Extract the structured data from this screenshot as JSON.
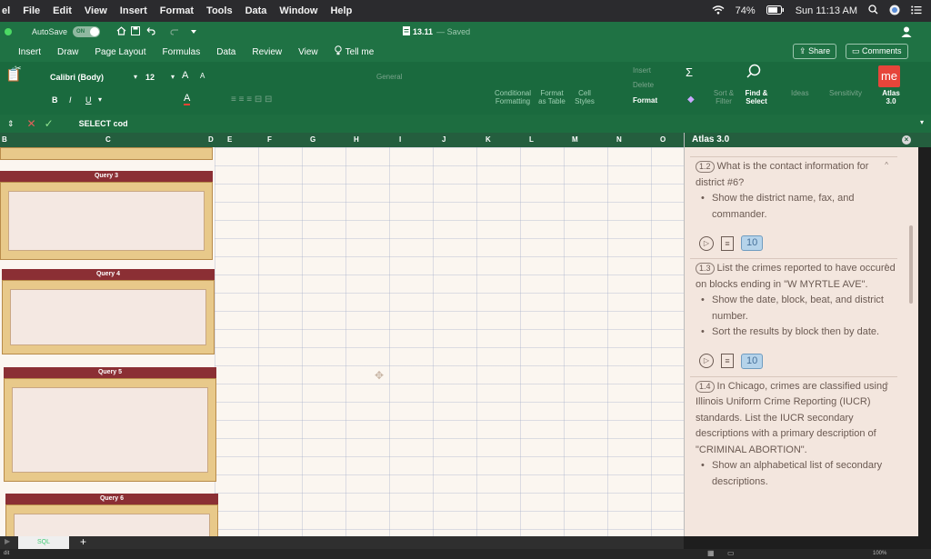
{
  "menubar": {
    "app_fragment": "el",
    "items": [
      "File",
      "Edit",
      "View",
      "Insert",
      "Format",
      "Tools",
      "Data",
      "Window",
      "Help"
    ],
    "battery": "74%",
    "clock": "Sun 11:13 AM"
  },
  "titlebar": {
    "autosave_label": "AutoSave",
    "autosave_state": "ON",
    "doc_name": "13.11",
    "saved": "— Saved"
  },
  "tabs": [
    "Insert",
    "Draw",
    "Page Layout",
    "Formulas",
    "Data",
    "Review",
    "View"
  ],
  "tell_me": "Tell me",
  "share": "Share",
  "comments": "Comments",
  "ribbon": {
    "font_name": "Calibri (Body)",
    "font_size": "12",
    "number_format": "General",
    "conditional_formatting": "Conditional Formatting",
    "format_as_table": "Format as Table",
    "cell_styles": "Cell Styles",
    "insert": "Insert",
    "delete": "Delete",
    "format": "Format",
    "sort_filter": "Sort & Filter",
    "find_select": "Find & Select",
    "ideas": "Ideas",
    "sensitivity": "Sensitivity",
    "atlas_logo": "me",
    "atlas_label": "Atlas 3.0"
  },
  "formula": {
    "content": "SELECT cod"
  },
  "columns": [
    "B",
    "C",
    "D",
    "E",
    "F",
    "G",
    "H",
    "I",
    "J",
    "K",
    "L",
    "M",
    "N",
    "O"
  ],
  "queries": [
    {
      "label": "Query 3"
    },
    {
      "label": "Query 4"
    },
    {
      "label": "Query 5"
    },
    {
      "label": "Query 6"
    }
  ],
  "atlas": {
    "title": "Atlas 3.0",
    "items": [
      {
        "num": "1.2",
        "text": "What is the contact information for district #6?",
        "bullets": [
          "Show the district name, fax, and commander."
        ],
        "badge": "10"
      },
      {
        "num": "1.3",
        "text": "List the crimes reported to have occured on blocks ending in \"W MYRTLE AVE\".",
        "bullets": [
          "Show the date, block, beat, and district number.",
          "Sort the results by block then by date."
        ],
        "badge": "10"
      },
      {
        "num": "1.4",
        "text": "In Chicago, crimes are classified using Illinois Uniform Crime Reporting (IUCR) standards. List the IUCR secondary descriptions with a primary description of \"CRIMINAL ABORTION\".",
        "bullets": [
          "Show an alphabetical list of secondary descriptions."
        ]
      }
    ]
  },
  "sheet_tab": "SQL",
  "add_sheet": "+",
  "status": {
    "left": "dit",
    "zoom": "100%"
  }
}
